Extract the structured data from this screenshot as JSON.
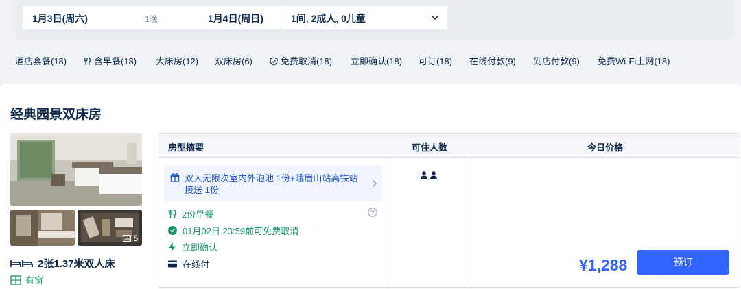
{
  "search": {
    "checkin": "1月3日(周六)",
    "nights": "1晚",
    "checkout": "1月4日(周日)",
    "occupancy": "1间, 2成人, 0儿童"
  },
  "filters": [
    {
      "label": "酒店套餐(18)",
      "icon": ""
    },
    {
      "label": "含早餐(18)",
      "icon": "fork-knife-icon"
    },
    {
      "label": "大床房(12)",
      "icon": ""
    },
    {
      "label": "双床房(6)",
      "icon": ""
    },
    {
      "label": "免费取消(18)",
      "icon": "shield-check-icon"
    },
    {
      "label": "立即确认(18)",
      "icon": ""
    },
    {
      "label": "可订(18)",
      "icon": ""
    },
    {
      "label": "在线付款(9)",
      "icon": ""
    },
    {
      "label": "到店付款(9)",
      "icon": ""
    },
    {
      "label": "免费Wi-Fi上网(18)",
      "icon": ""
    }
  ],
  "room": {
    "title": "经典园景双床房",
    "photo_count": "5",
    "bed": "2张1.37米双人床",
    "window": "有窗",
    "table_headers": {
      "summary": "房型摘要",
      "occupancy": "可住人数",
      "price": "今日价格"
    },
    "package": "双人无限次室内外泡池 1份+峨眉山站高铁站接送 1份",
    "perks": {
      "breakfast": "2份早餐",
      "cancel": "01月02日 23:59前可免费取消",
      "confirm": "立即确认",
      "payment": "在线付"
    },
    "guests": 2,
    "price": "¥1,288",
    "book_label": "预订"
  },
  "colors": {
    "accent": "#3264ff",
    "green": "#14956a",
    "text": "#0f294d"
  }
}
